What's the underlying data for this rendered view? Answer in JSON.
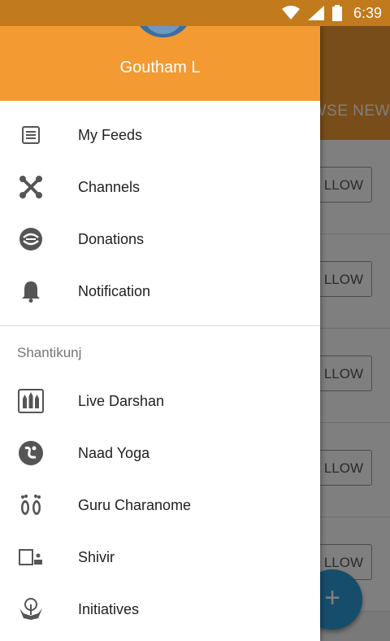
{
  "status_bar": {
    "time": "6:39"
  },
  "background": {
    "tab_label": "WSE NEW",
    "follow_label": "LLOW",
    "fab_label": "+"
  },
  "drawer": {
    "user_name": "Goutham L",
    "items": [
      {
        "label": "My Feeds",
        "icon": "feed-icon"
      },
      {
        "label": "Channels",
        "icon": "channels-icon"
      },
      {
        "label": "Donations",
        "icon": "donations-icon"
      },
      {
        "label": "Notification",
        "icon": "bell-icon"
      }
    ],
    "section_title": "Shantikunj",
    "section_items": [
      {
        "label": "Live Darshan",
        "icon": "live-darshan-icon"
      },
      {
        "label": "Naad Yoga",
        "icon": "naad-yoga-icon"
      },
      {
        "label": "Guru Charanome",
        "icon": "footprints-icon"
      },
      {
        "label": "Shivir",
        "icon": "shivir-icon"
      },
      {
        "label": "Initiatives",
        "icon": "initiatives-icon"
      }
    ]
  },
  "colors": {
    "accent": "#f39a33",
    "status_bar": "#c17a1c",
    "fab": "#2d9bd6"
  }
}
